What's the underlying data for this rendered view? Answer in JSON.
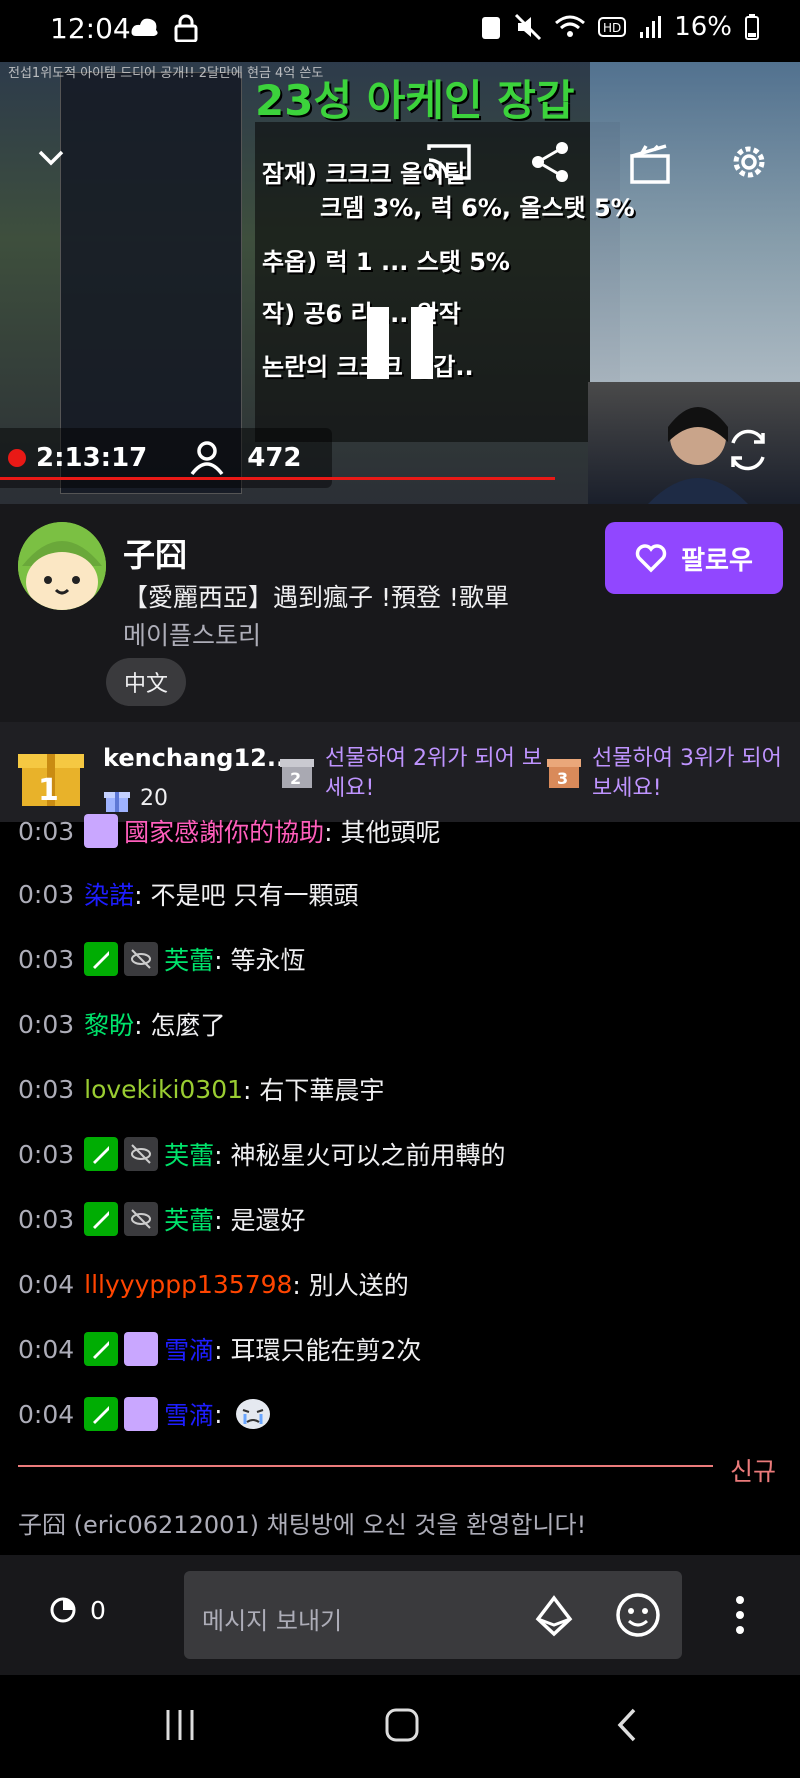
{
  "status_bar": {
    "time": "12:04",
    "battery": "16%"
  },
  "video": {
    "overlay_title": "전섭1위도적 아이템 드디어 공개!! 2달만에 현금 4억 쓴도",
    "big_title": "23성 아케인 장갑",
    "lines": [
      "잠재) 크크크 올이탈",
      "크뎀 3%, 럭 6%, 올스탯 5%",
      "추옵) 럭 1 ... 스탯 5%",
      "작) 공6 리 ... 완작",
      "논란의 크크크 장갑.."
    ],
    "stream_time": "2:13:17",
    "viewers": "472"
  },
  "channel": {
    "name": "子囧",
    "title": "【愛麗西亞】遇到瘋子 !預登 !歌單",
    "category": "메이플스토리",
    "tag": "中文",
    "follow_label": "팔로우"
  },
  "gifts": {
    "rank1_name": "kenchang12...",
    "rank1_count": "20",
    "rank2_text": "선물하여 2위가 되어 보세요!",
    "rank3_text": "선물하여 3위가 되어 보세요!"
  },
  "chat": {
    "messages": [
      {
        "time": "0:03",
        "user": "國家感謝你的協助",
        "text": ": 其他頭呢",
        "color": "#ff5ebc"
      },
      {
        "time": "0:03",
        "user": "染諾",
        "text": ": 不是吧 只有一顆頭",
        "color": "#1e1eff"
      },
      {
        "time": "0:03",
        "user": "芙蕾",
        "text": ": 等永恆",
        "color": "#00e36b"
      },
      {
        "time": "0:03",
        "user": "黎盼",
        "text": ": 怎麼了",
        "color": "#00e36b"
      },
      {
        "time": "0:03",
        "user": "lovekiki0301",
        "text": ": 右下華晨宇",
        "color": "#9acd32"
      },
      {
        "time": "0:03",
        "user": "芙蕾",
        "text": ": 神秘星火可以之前用轉的",
        "color": "#00e36b"
      },
      {
        "time": "0:03",
        "user": "芙蕾",
        "text": ": 是還好",
        "color": "#00e36b"
      },
      {
        "time": "0:04",
        "user": "lllyyyppp135798",
        "text": ": 別人送的",
        "color": "#ff4500"
      },
      {
        "time": "0:04",
        "user": "雪滴",
        "text": ": 耳環只能在剪2次",
        "color": "#1e1eff"
      },
      {
        "time": "0:04",
        "user": "雪滴",
        "text": ":",
        "color": "#1e1eff"
      }
    ],
    "new_label": "신규",
    "welcome": "子囧 (eric06212001) 채팅방에 오신 것을 환영합니다!"
  },
  "input": {
    "points": "0",
    "placeholder": "메시지 보내기"
  },
  "colors": {
    "accent": "#9147ff",
    "live": "#e91916"
  }
}
